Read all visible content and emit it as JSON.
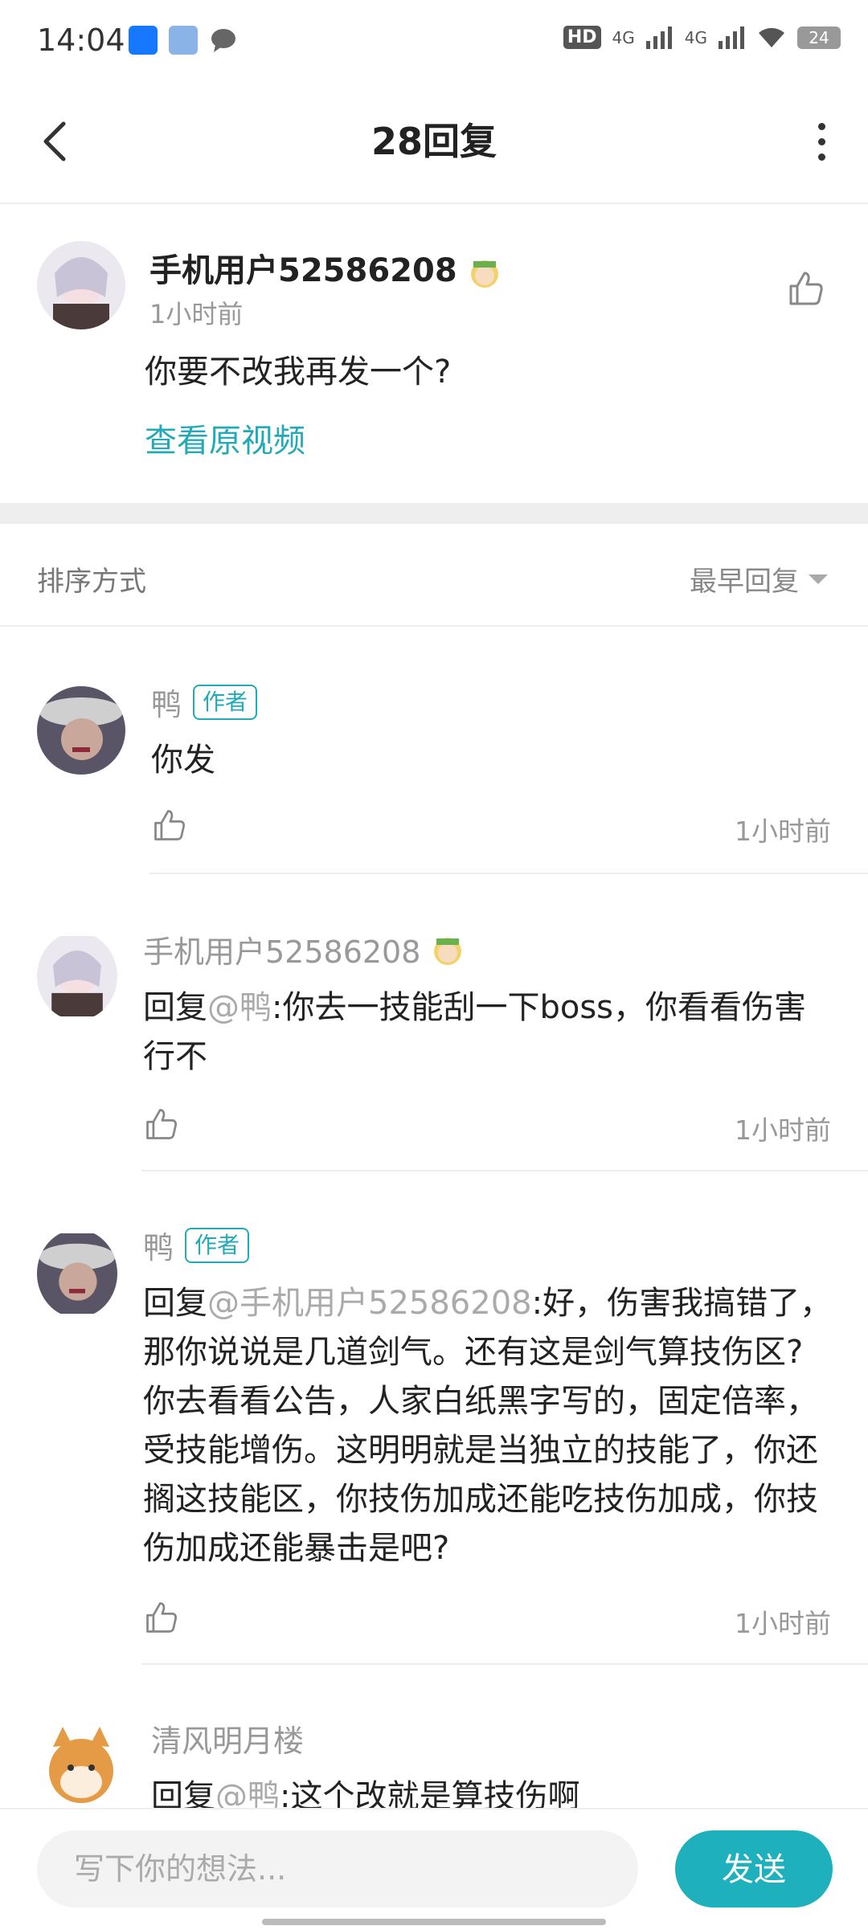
{
  "status": {
    "time": "14:04",
    "battery": "24",
    "hd_label": "HD",
    "net1": "4G",
    "net2": "4G"
  },
  "nav": {
    "title": "28回复"
  },
  "post": {
    "username": "手机用户52586208",
    "time": "1小时前",
    "content": "你要不改我再发一个?",
    "view_original": "查看原视频"
  },
  "sort": {
    "label": "排序方式",
    "selected": "最早回复"
  },
  "replies": [
    {
      "name": "鸭",
      "tag": "作者",
      "prefix": "",
      "mention": "",
      "text": "你发",
      "time": "1小时前"
    },
    {
      "name": "手机用户52586208",
      "tag": "",
      "prefix": "回复",
      "mention": "@鸭",
      "text": ":你去一技能刮一下boss，你看看伤害行不",
      "time": "1小时前"
    },
    {
      "name": "鸭",
      "tag": "作者",
      "prefix": "回复",
      "mention": "@手机用户52586208",
      "text": ":好，伤害我搞错了，那你说说是几道剑气。还有这是剑气算技伤区?你去看看公告，人家白纸黑字写的，固定倍率，受技能增伤。这明明就是当独立的技能了，你还搁这技能区，你技伤加成还能吃技伤加成，你技伤加成还能暴击是吧?",
      "time": "1小时前"
    },
    {
      "name": "清风明月楼",
      "tag": "",
      "prefix": "回复",
      "mention": "@鸭",
      "text": ":这个改就是算技伤啊",
      "time": ""
    }
  ],
  "input": {
    "placeholder": "写下你的想法...",
    "send_label": "发送"
  },
  "colors": {
    "accent": "#1fb0bd",
    "author_tag": "#23aab8",
    "link": "#23aab8"
  }
}
